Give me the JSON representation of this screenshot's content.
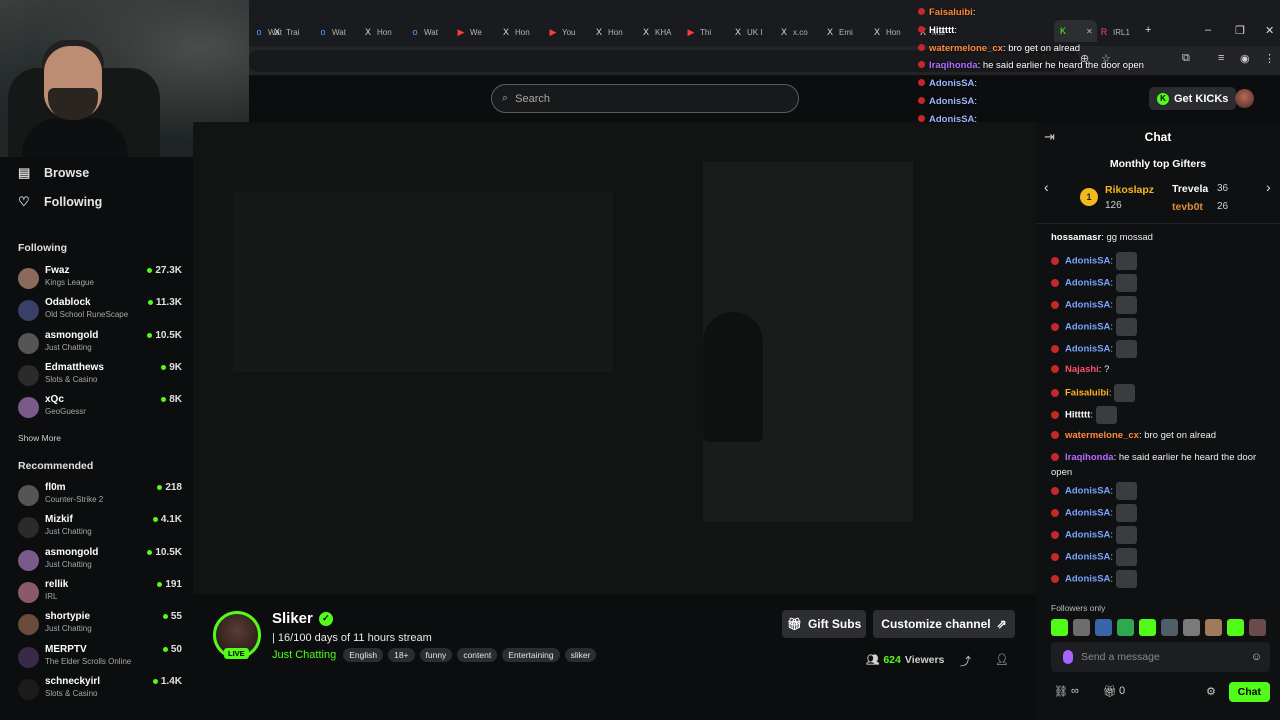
{
  "browser": {
    "tabs": [
      {
        "label": "Wat",
        "icon": "o"
      },
      {
        "label": "Trai",
        "icon": "X"
      },
      {
        "label": "Wat",
        "icon": "o"
      },
      {
        "label": "Hon",
        "icon": "X"
      },
      {
        "label": "Wat",
        "icon": "o"
      },
      {
        "label": "We",
        "icon": "▶"
      },
      {
        "label": "Hon",
        "icon": "X"
      },
      {
        "label": "You",
        "icon": "▶"
      },
      {
        "label": "Hon",
        "icon": "X"
      },
      {
        "label": "KHA",
        "icon": "X"
      },
      {
        "label": "Thi",
        "icon": "▶"
      },
      {
        "label": "UK I",
        "icon": "X"
      },
      {
        "label": "x.co",
        "icon": "X"
      },
      {
        "label": "Emi",
        "icon": "X"
      },
      {
        "label": "Hon",
        "icon": "X"
      },
      {
        "label": "Mal",
        "icon": "X"
      },
      {
        "label": "",
        "icon": "K"
      },
      {
        "label": "IRL1",
        "icon": "R"
      }
    ]
  },
  "search": {
    "placeholder": "Search"
  },
  "header": {
    "get_kicks": "Get KICKs"
  },
  "sidebar": {
    "browse": "Browse",
    "following_nav": "Following",
    "following_title": "Following",
    "following": [
      {
        "name": "Fwaz",
        "category": "Kings League",
        "viewers": "27.3K"
      },
      {
        "name": "Odablock",
        "category": "Old School RuneScape",
        "viewers": "11.3K"
      },
      {
        "name": "asmongold",
        "category": "Just Chatting",
        "viewers": "10.5K"
      },
      {
        "name": "Edmatthews",
        "category": "Slots & Casino",
        "viewers": "9K"
      },
      {
        "name": "xQc",
        "category": "GeoGuessr",
        "viewers": "8K"
      }
    ],
    "show_more": "Show More",
    "recommended_title": "Recommended",
    "recommended": [
      {
        "name": "fl0m",
        "category": "Counter-Strike 2",
        "viewers": "218"
      },
      {
        "name": "Mizkif",
        "category": "Just Chatting",
        "viewers": "4.1K"
      },
      {
        "name": "asmongold",
        "category": "Just Chatting",
        "viewers": "10.5K"
      },
      {
        "name": "rellik",
        "category": "IRL",
        "viewers": "191"
      },
      {
        "name": "shortypie",
        "category": "Just Chatting",
        "viewers": "55"
      },
      {
        "name": "MERPTV",
        "category": "The Elder Scrolls Online",
        "viewers": "50"
      },
      {
        "name": "schneckyirl",
        "category": "Slots & Casino",
        "viewers": "1.4K"
      }
    ]
  },
  "channel": {
    "name": "Sliker",
    "live_badge": "LIVE",
    "stream_title": "| 16/100 days of 11 hours stream",
    "category": "Just Chatting",
    "tags": [
      "English",
      "18+",
      "funny",
      "content",
      "Entertaining",
      "sliker"
    ],
    "gift_subs": "Gift Subs",
    "customize": "Customize channel",
    "viewers": "624",
    "viewers_label": "Viewers"
  },
  "chat": {
    "title": "Chat",
    "gifters_title": "Monthly top Gifters",
    "gifters": [
      {
        "rank": "1",
        "name": "Rikoslapz",
        "count": "126"
      },
      {
        "name": "Trevela",
        "count": "36"
      },
      {
        "name": "tevb0t",
        "count": "26"
      }
    ],
    "messages": [
      {
        "user": "hossamasr",
        "text": ": gg mossad",
        "color": "#ffffff"
      },
      {
        "user": "AdonisSA",
        "text": ":",
        "color": "#7aa2ff"
      },
      {
        "user": "AdonisSA",
        "text": ":",
        "color": "#7aa2ff"
      },
      {
        "user": "AdonisSA",
        "text": ":",
        "color": "#7aa2ff"
      },
      {
        "user": "AdonisSA",
        "text": ":",
        "color": "#7aa2ff"
      },
      {
        "user": "AdonisSA",
        "text": ":",
        "color": "#7aa2ff"
      },
      {
        "user": "Najashi",
        "text": ": ?",
        "color": "#ff4d6d"
      },
      {
        "user": "Faisaluibi",
        "text": ":",
        "color": "#ffb020"
      },
      {
        "user": "Hittttt",
        "text": ":",
        "color": "#ffffff"
      },
      {
        "user": "watermelone_cx",
        "text": ": bro get on alread",
        "color": "#ff8a3d"
      },
      {
        "user": "Iraqihonda",
        "text": ": he said earlier he heard the door open",
        "color": "#b36bff"
      },
      {
        "user": "AdonisSA",
        "text": ":",
        "color": "#7aa2ff"
      },
      {
        "user": "AdonisSA",
        "text": ":",
        "color": "#7aa2ff"
      },
      {
        "user": "AdonisSA",
        "text": ":",
        "color": "#7aa2ff"
      },
      {
        "user": "AdonisSA",
        "text": ":",
        "color": "#7aa2ff"
      },
      {
        "user": "AdonisSA",
        "text": ":",
        "color": "#7aa2ff"
      }
    ],
    "followers_only": "Followers only",
    "send_placeholder": "Send a message",
    "gift_count": "0",
    "chat_button": "Chat"
  },
  "stream_overlay": {
    "lines": [
      {
        "user": "Faisaluibi",
        "text": ":",
        "color": "#ff8a3d"
      },
      {
        "user": "Hittttt",
        "text": ":",
        "color": "#ffffff"
      },
      {
        "user": "watermelone_cx",
        "text": ": bro get on alread",
        "color": "#ff8a3d"
      },
      {
        "user": "Iraqihonda",
        "text": ": he said earlier he heard the door open",
        "color": "#b36bff"
      },
      {
        "user": "AdonisSA",
        "text": ":",
        "color": "#9bb5ff"
      },
      {
        "user": "AdonisSA",
        "text": ":",
        "color": "#9bb5ff"
      },
      {
        "user": "AdonisSA",
        "text": ":",
        "color": "#9bb5ff"
      }
    ]
  },
  "colors": {
    "accent": "#53fc18",
    "background": "#0b0d0e"
  }
}
